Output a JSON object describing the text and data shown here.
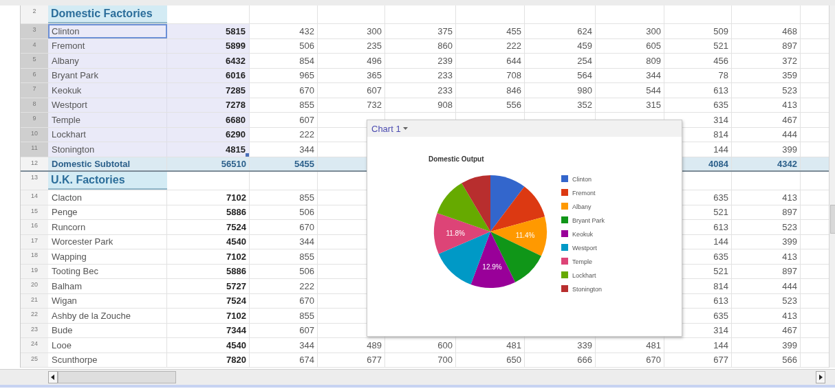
{
  "sheet": {
    "rows": [
      {
        "number": "2",
        "kind": "section",
        "selected": false,
        "label": "Domestic Factories"
      },
      {
        "number": "3",
        "kind": "data",
        "selected": true,
        "active": true,
        "label": "Clinton",
        "total": "5815",
        "values": [
          "432",
          "300",
          "375",
          "455",
          "624",
          "300",
          "509",
          "468"
        ]
      },
      {
        "number": "4",
        "kind": "data",
        "selected": true,
        "active": false,
        "label": "Fremont",
        "total": "5899",
        "values": [
          "506",
          "235",
          "860",
          "222",
          "459",
          "605",
          "521",
          "897"
        ]
      },
      {
        "number": "5",
        "kind": "data",
        "selected": true,
        "active": false,
        "label": "Albany",
        "total": "6432",
        "values": [
          "854",
          "496",
          "239",
          "644",
          "254",
          "809",
          "456",
          "372"
        ]
      },
      {
        "number": "6",
        "kind": "data",
        "selected": true,
        "active": false,
        "label": "Bryant Park",
        "total": "6016",
        "values": [
          "965",
          "365",
          "233",
          "708",
          "564",
          "344",
          "78",
          "359"
        ]
      },
      {
        "number": "7",
        "kind": "data",
        "selected": true,
        "active": false,
        "label": "Keokuk",
        "total": "7285",
        "values": [
          "670",
          "607",
          "233",
          "846",
          "980",
          "544",
          "613",
          "523"
        ]
      },
      {
        "number": "8",
        "kind": "data",
        "selected": true,
        "active": false,
        "label": "Westport",
        "total": "7278",
        "values": [
          "855",
          "732",
          "908",
          "556",
          "352",
          "315",
          "635",
          "413"
        ]
      },
      {
        "number": "9",
        "kind": "data",
        "selected": true,
        "active": false,
        "label": "Temple",
        "total": "6680",
        "values": [
          "607"
        ],
        "right_values": [
          "314",
          "467"
        ]
      },
      {
        "number": "10",
        "kind": "data",
        "selected": true,
        "active": false,
        "label": "Lockhart",
        "total": "6290",
        "values": [
          "222"
        ],
        "right_values": [
          "814",
          "444"
        ]
      },
      {
        "number": "11",
        "kind": "data",
        "selected": true,
        "active": false,
        "label": "Stonington",
        "total": "4815",
        "values": [
          "344"
        ],
        "right_values": [
          "144",
          "399"
        ]
      },
      {
        "number": "12",
        "kind": "subtotal",
        "selected": false,
        "active": false,
        "label": "Domestic Subtotal",
        "total": "56510",
        "values": [
          "5455"
        ],
        "right_values": [
          "4084",
          "4342"
        ]
      },
      {
        "number": "13",
        "kind": "section",
        "selected": false,
        "label": "U.K. Factories"
      },
      {
        "number": "14",
        "kind": "data",
        "selected": false,
        "active": false,
        "label": "Clacton",
        "total": "7102",
        "values": [
          "855"
        ],
        "right_values": [
          "635",
          "413"
        ]
      },
      {
        "number": "15",
        "kind": "data",
        "selected": false,
        "active": false,
        "label": "Penge",
        "total": "5886",
        "values": [
          "506"
        ],
        "right_values": [
          "521",
          "897"
        ]
      },
      {
        "number": "16",
        "kind": "data",
        "selected": false,
        "active": false,
        "label": "Runcorn",
        "total": "7524",
        "values": [
          "670"
        ],
        "right_values": [
          "613",
          "523"
        ]
      },
      {
        "number": "17",
        "kind": "data",
        "selected": false,
        "active": false,
        "label": "Worcester Park",
        "total": "4540",
        "values": [
          "344"
        ],
        "right_values": [
          "144",
          "399"
        ]
      },
      {
        "number": "18",
        "kind": "data",
        "selected": false,
        "active": false,
        "label": "Wapping",
        "total": "7102",
        "values": [
          "855"
        ],
        "right_values": [
          "635",
          "413"
        ]
      },
      {
        "number": "19",
        "kind": "data",
        "selected": false,
        "active": false,
        "label": "Tooting Bec",
        "total": "5886",
        "values": [
          "506"
        ],
        "right_values": [
          "521",
          "897"
        ]
      },
      {
        "number": "20",
        "kind": "data",
        "selected": false,
        "active": false,
        "label": "Balham",
        "total": "5727",
        "values": [
          "222"
        ],
        "right_values": [
          "814",
          "444"
        ]
      },
      {
        "number": "21",
        "kind": "data",
        "selected": false,
        "active": false,
        "label": "Wigan",
        "total": "7524",
        "values": [
          "670"
        ],
        "right_values": [
          "613",
          "523"
        ]
      },
      {
        "number": "22",
        "kind": "data",
        "selected": false,
        "active": false,
        "label": "Ashby de la Zouche",
        "total": "7102",
        "values": [
          "855"
        ],
        "right_values": [
          "635",
          "413"
        ]
      },
      {
        "number": "23",
        "kind": "data",
        "selected": false,
        "active": false,
        "label": "Bude",
        "total": "7344",
        "values": [
          "607"
        ],
        "right_values": [
          "314",
          "467"
        ]
      },
      {
        "number": "24",
        "kind": "data",
        "selected": false,
        "active": false,
        "label": "Looe",
        "total": "4540",
        "values": [
          "344",
          "489",
          "600",
          "481",
          "339",
          "481",
          "144",
          "399"
        ]
      },
      {
        "number": "25",
        "kind": "data",
        "selected": false,
        "active": false,
        "label": "Scunthorpe",
        "total": "7820",
        "values": [
          "674",
          "677",
          "700",
          "650",
          "666",
          "670",
          "677",
          "566"
        ]
      }
    ]
  },
  "chart": {
    "name": "Chart 1",
    "chart_data": {
      "type": "pie",
      "title": "Domestic Output",
      "legend": "right",
      "categories": [
        "Clinton",
        "Fremont",
        "Albany",
        "Bryant Park",
        "Keokuk",
        "Westport",
        "Temple",
        "Lockhart",
        "Stonington"
      ],
      "values": [
        10.29,
        10.44,
        11.38,
        10.65,
        12.89,
        12.88,
        11.82,
        11.13,
        8.52
      ],
      "colors": [
        "#3366cc",
        "#dc3912",
        "#ff9900",
        "#109618",
        "#990099",
        "#0099c6",
        "#dd4477",
        "#66aa00",
        "#b82e2e"
      ],
      "value_labels": [
        null,
        null,
        "11.4%",
        null,
        "12.9%",
        null,
        "11.8%",
        null,
        null
      ]
    }
  }
}
